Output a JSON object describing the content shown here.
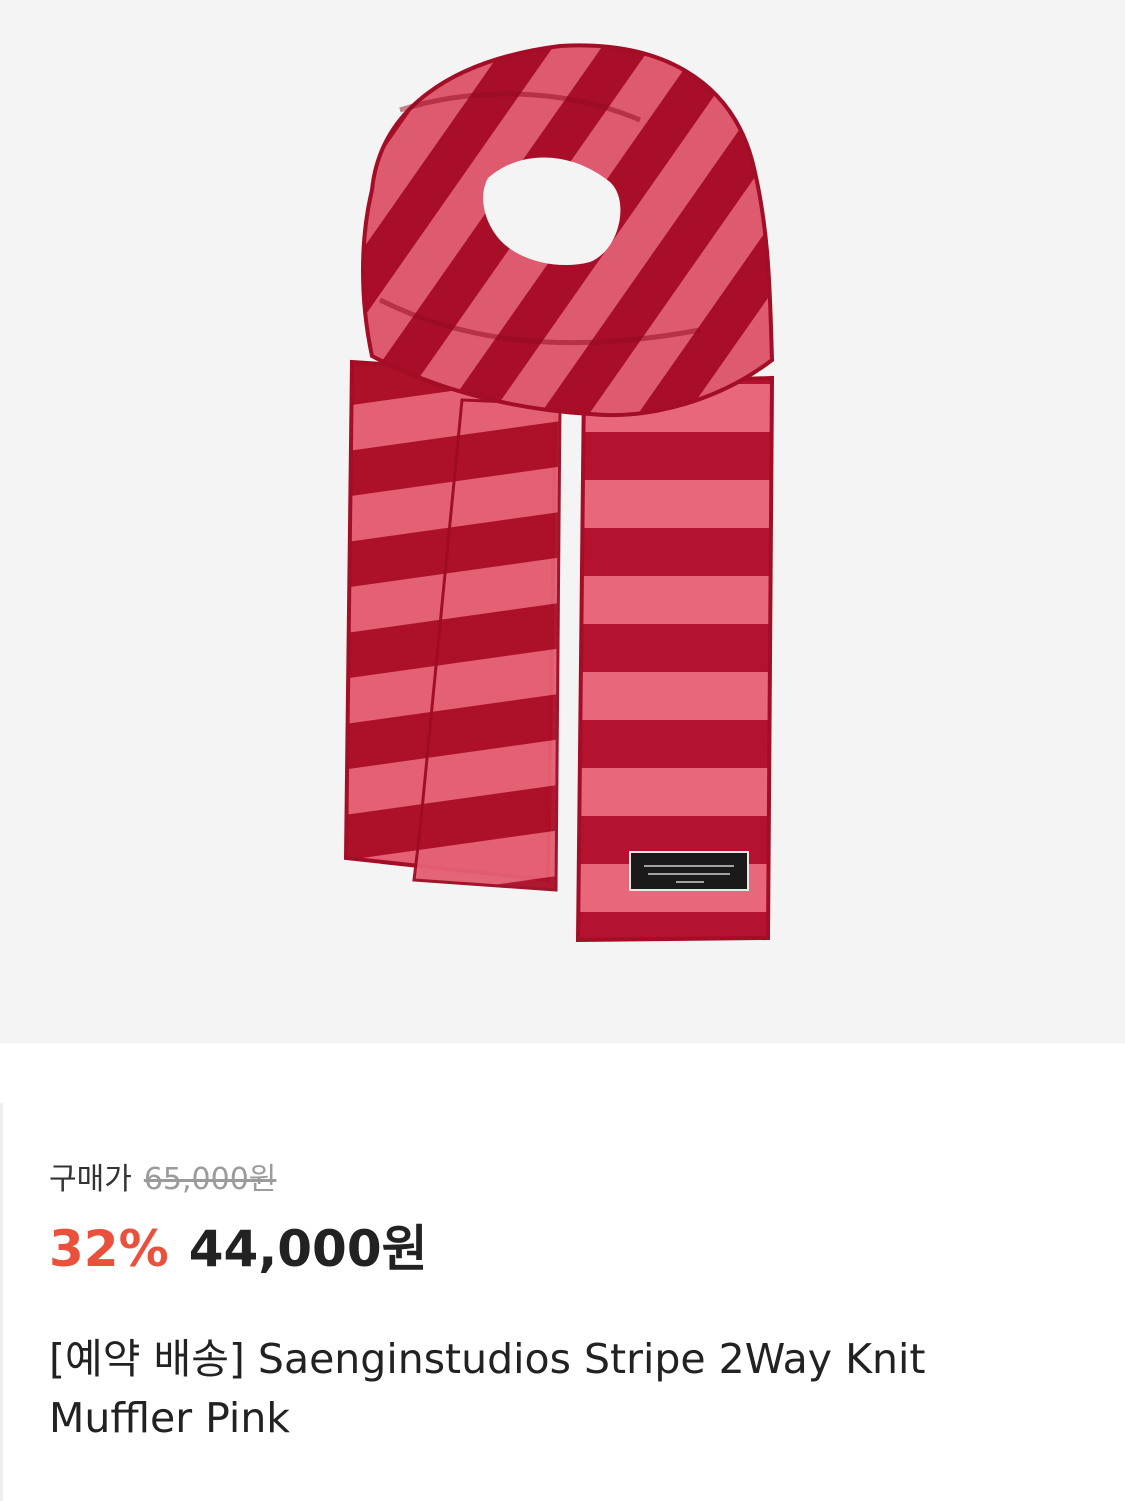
{
  "product": {
    "image_name": "striped-knit-scarf",
    "price_label": "구매가",
    "original_price": "65,000원",
    "discount_rate": "32%",
    "sale_price": "44,000원",
    "title": "[예약 배송] Saenginstudios Stripe 2Way Knit Muffler Pink"
  },
  "colors": {
    "image_background": "#f4f4f4",
    "discount": "#e9513d",
    "text_primary": "#222222",
    "text_muted": "#9b9b9b",
    "scarf_dark_red": "#b5122f",
    "scarf_pink": "#e8677a"
  }
}
